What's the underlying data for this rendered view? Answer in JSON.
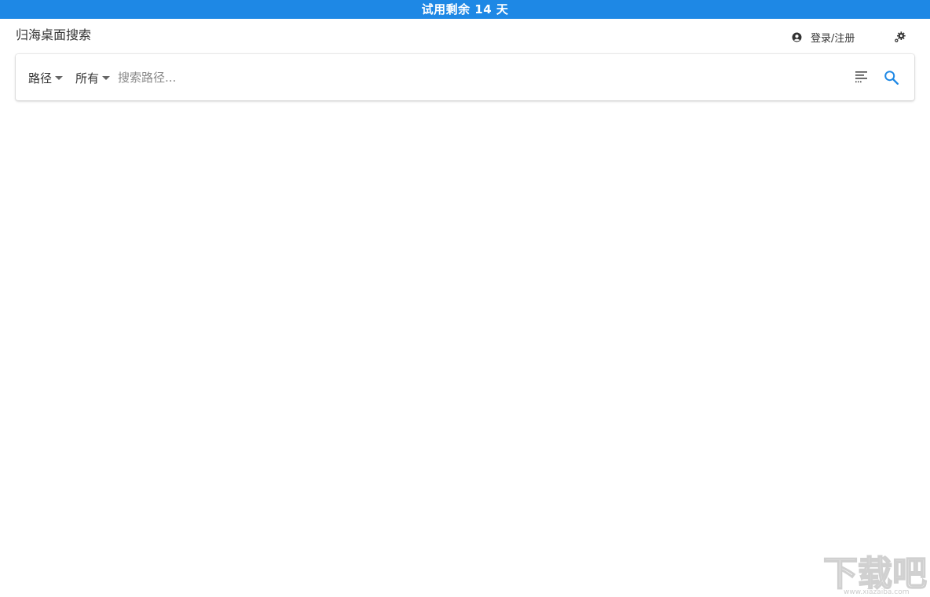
{
  "banner": {
    "text": "试用剩余 14 天",
    "color": "#1e88e5"
  },
  "header": {
    "app_title": "归海桌面搜索",
    "login_label": "登录/注册",
    "login_icon": "user-circle-icon",
    "settings_icon": "gear-icon"
  },
  "search_bar": {
    "scope_dropdown": "路径",
    "type_dropdown": "所有",
    "input_value": "",
    "input_placeholder": "搜索路径...",
    "filter_icon": "sort-lines-icon",
    "search_icon": "search-icon",
    "search_icon_color": "#1e88e5"
  },
  "watermark": {
    "logo_text": "下载吧",
    "url": "www.xiazaiba.com"
  }
}
